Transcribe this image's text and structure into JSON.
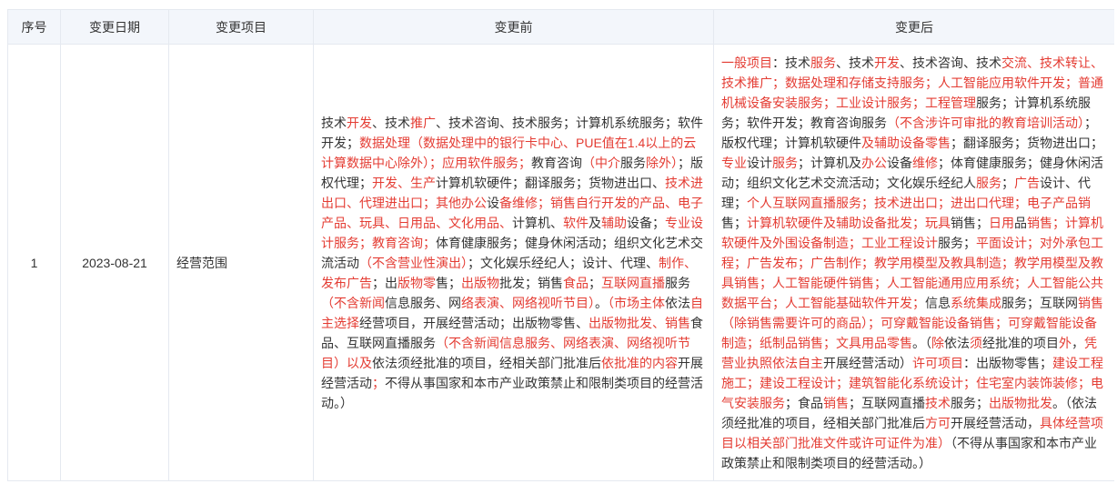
{
  "colors": {
    "highlight": "#e43c33",
    "text": "#333333",
    "header_bg": "#f3f6fb",
    "border": "#e5e9f0"
  },
  "table": {
    "headers": [
      "序号",
      "变更日期",
      "变更项目",
      "变更前",
      "变更后"
    ],
    "rows": [
      {
        "index": "1",
        "date": "2023-08-21",
        "item": "经营范围",
        "before": [
          {
            "text": "技术",
            "changed": false
          },
          {
            "text": "开发",
            "changed": true
          },
          {
            "text": "、技术",
            "changed": false
          },
          {
            "text": "推广",
            "changed": true
          },
          {
            "text": "、技术咨询、技术服务；计算机系统服务；软件开发；",
            "changed": false
          },
          {
            "text": "数据处理（数据处理中的银行卡中心、PUE值在1.4以上的云计算数据中心除外）；应用软件服务；",
            "changed": true
          },
          {
            "text": "教育咨询",
            "changed": false
          },
          {
            "text": "（中介",
            "changed": true
          },
          {
            "text": "服务",
            "changed": false
          },
          {
            "text": "除外）",
            "changed": true
          },
          {
            "text": "；版权代理；",
            "changed": false
          },
          {
            "text": "开发、生产",
            "changed": true
          },
          {
            "text": "计算机软硬件；翻译服务；货物进出口、",
            "changed": false
          },
          {
            "text": "技术进出口、代理进出口；其他办公",
            "changed": true
          },
          {
            "text": "设",
            "changed": false
          },
          {
            "text": "备维修；销售自行开发的产品、电子产品、玩具、日用品、文化用品、",
            "changed": true
          },
          {
            "text": "计算机、",
            "changed": false
          },
          {
            "text": "软件",
            "changed": true
          },
          {
            "text": "及",
            "changed": false
          },
          {
            "text": "辅助",
            "changed": true
          },
          {
            "text": "设备；",
            "changed": false
          },
          {
            "text": "专业设计服务；教育咨询；",
            "changed": true
          },
          {
            "text": "体育健康服务；健身休闲活动；组织文化艺术交流活动",
            "changed": false
          },
          {
            "text": "（不含营业性演出）",
            "changed": true
          },
          {
            "text": "；文化娱乐经纪人；设计、代理、",
            "changed": false
          },
          {
            "text": "制作、发布广告",
            "changed": true
          },
          {
            "text": "；出",
            "changed": false
          },
          {
            "text": "版物零",
            "changed": true
          },
          {
            "text": "售；",
            "changed": false
          },
          {
            "text": "出版物",
            "changed": true
          },
          {
            "text": "批发；销售",
            "changed": false
          },
          {
            "text": "食品",
            "changed": true
          },
          {
            "text": "；",
            "changed": false
          },
          {
            "text": "互联网直播",
            "changed": true
          },
          {
            "text": "服务",
            "changed": false
          },
          {
            "text": "（不含新闻",
            "changed": true
          },
          {
            "text": "信息服务、网",
            "changed": false
          },
          {
            "text": "络表演、网络视听节目）",
            "changed": true
          },
          {
            "text": "。",
            "changed": false
          },
          {
            "text": "（市场主体",
            "changed": true
          },
          {
            "text": "依法",
            "changed": false
          },
          {
            "text": "自主选择",
            "changed": true
          },
          {
            "text": "经营项目，开展经营活动；出版物零售、",
            "changed": false
          },
          {
            "text": "出版物批发、销售",
            "changed": true
          },
          {
            "text": "食品、互联网直播服务",
            "changed": false
          },
          {
            "text": "（不含新闻信息服务、网络表演、网络视听节目）以及",
            "changed": true
          },
          {
            "text": "依法须经批准的项目，经相关部门批准后",
            "changed": false
          },
          {
            "text": "依批准的内容",
            "changed": true
          },
          {
            "text": "开展经营活动",
            "changed": false
          },
          {
            "text": "；",
            "changed": true
          },
          {
            "text": "不得从事国家和本市产业政策禁止和限制类项目的经营活动。）",
            "changed": false
          }
        ],
        "after": [
          {
            "text": "一般项目",
            "changed": true
          },
          {
            "text": "：技术",
            "changed": false
          },
          {
            "text": "服务",
            "changed": true
          },
          {
            "text": "、技术",
            "changed": false
          },
          {
            "text": "开发",
            "changed": true
          },
          {
            "text": "、技术咨询、技术",
            "changed": false
          },
          {
            "text": "交流、技术转让、技术推广；数据处理和存储支持服务；人工智能应用软件开发；普通机械设备安装服务；工业设计服务；工程管理",
            "changed": true
          },
          {
            "text": "服务；计算机系统服务；软件开发；教育咨询服务",
            "changed": false
          },
          {
            "text": "（不含涉许可审批的教育培训活动）",
            "changed": true
          },
          {
            "text": "；版权代理；计算机软硬件",
            "changed": false
          },
          {
            "text": "及辅助设备零售",
            "changed": true
          },
          {
            "text": "；翻译服务；货物进出口；",
            "changed": false
          },
          {
            "text": "专业",
            "changed": true
          },
          {
            "text": "设计",
            "changed": false
          },
          {
            "text": "服务",
            "changed": true
          },
          {
            "text": "；计算机及",
            "changed": false
          },
          {
            "text": "办公",
            "changed": true
          },
          {
            "text": "设备",
            "changed": false
          },
          {
            "text": "维修",
            "changed": true
          },
          {
            "text": "；体育健康服务；健身休闲活动；组织文化艺术交流活动；文化娱乐经纪人",
            "changed": false
          },
          {
            "text": "服务",
            "changed": true
          },
          {
            "text": "；",
            "changed": false
          },
          {
            "text": "广告",
            "changed": true
          },
          {
            "text": "设计、代理；",
            "changed": false
          },
          {
            "text": "个人互联网直播服务；技术进出口；进出口代理；电子产品销",
            "changed": true
          },
          {
            "text": "售；",
            "changed": false
          },
          {
            "text": "计算机软硬件及辅助设备批发；玩具",
            "changed": true
          },
          {
            "text": "销售；",
            "changed": false
          },
          {
            "text": "日用",
            "changed": true
          },
          {
            "text": "品",
            "changed": false
          },
          {
            "text": "销售；计算机软硬件及外围设备制造；工业工程设计",
            "changed": true
          },
          {
            "text": "服务；",
            "changed": false
          },
          {
            "text": "平面设计；对外承包工程；广告发布；广告制作；教学用模型及教具制造；教学用模型及教具销售；人工智能硬件销售；人工智能通用应用系统；人工智能公共数据平台；人工智能基础软件开发；",
            "changed": true
          },
          {
            "text": "信息",
            "changed": false
          },
          {
            "text": "系统集成",
            "changed": true
          },
          {
            "text": "服务；互联网",
            "changed": false
          },
          {
            "text": "销售（除销售需要许可的商品）；可穿戴智能设备销售；可穿戴智能设备制造；纸制品销售；文具用品零售",
            "changed": true
          },
          {
            "text": "。（",
            "changed": false
          },
          {
            "text": "除",
            "changed": true
          },
          {
            "text": "依法",
            "changed": false
          },
          {
            "text": "须",
            "changed": true
          },
          {
            "text": "经批准的项目",
            "changed": false
          },
          {
            "text": "外",
            "changed": true
          },
          {
            "text": "，",
            "changed": false
          },
          {
            "text": "凭营业执照依法自主",
            "changed": true
          },
          {
            "text": "开展经营活动）",
            "changed": false
          },
          {
            "text": "许可项目",
            "changed": true
          },
          {
            "text": "：出版物零售；",
            "changed": false
          },
          {
            "text": "建设工程施工；建设工程设计；建筑智能化系统设计；住宅室内装饰装修；电气安装服务",
            "changed": true
          },
          {
            "text": "；食品",
            "changed": false
          },
          {
            "text": "销售",
            "changed": true
          },
          {
            "text": "；互联网直播",
            "changed": false
          },
          {
            "text": "技术",
            "changed": true
          },
          {
            "text": "服务；",
            "changed": false
          },
          {
            "text": "出版物批发",
            "changed": true
          },
          {
            "text": "。（依法须经批准的项目，经相关部门批准后",
            "changed": false
          },
          {
            "text": "方可",
            "changed": true
          },
          {
            "text": "开展经营活动，",
            "changed": false
          },
          {
            "text": "具体经营项目以相关部门批准文件或许可证件为准）",
            "changed": true
          },
          {
            "text": "（不得从事国家和本市产业政策禁止和限制类项目的经营活动。）",
            "changed": false
          }
        ]
      }
    ]
  }
}
